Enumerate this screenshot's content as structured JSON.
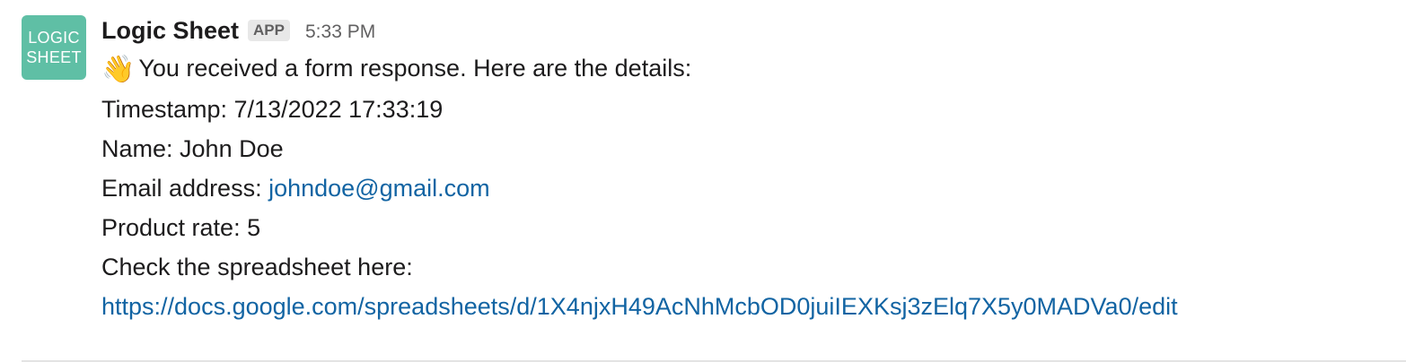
{
  "message": {
    "avatar": {
      "line1": "LOGIC",
      "line2": "SHEET",
      "color": "#5fbfa5"
    },
    "sender": "Logic Sheet",
    "badge": "APP",
    "time": "5:33 PM",
    "intro_emoji": "👋",
    "intro_text": "You received a form response. Here are the details:",
    "timestamp_label": "Timestamp: ",
    "timestamp_value": "7/13/2022 17:33:19",
    "name_label": "Name: ",
    "name_value": "John Doe",
    "email_label": "Email address: ",
    "email_value": "johndoe@gmail.com",
    "rate_label": "Product rate: ",
    "rate_value": "5",
    "check_text": "Check the spreadsheet here:",
    "spreadsheet_url": "https://docs.google.com/spreadsheets/d/1X4njxH49AcNhMcbOD0juiIEXKsj3zElq7X5y0MADVa0/edit",
    "link_color": "#1264a3"
  }
}
